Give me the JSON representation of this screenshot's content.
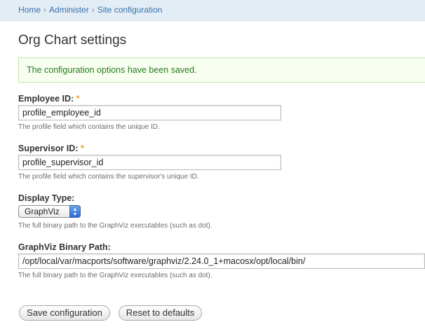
{
  "breadcrumb": {
    "items": [
      "Home",
      "Administer",
      "Site configuration"
    ],
    "separator": "›"
  },
  "page_title": "Org Chart settings",
  "status_message": "The configuration options have been saved.",
  "form": {
    "required_marker": "*",
    "employee_id": {
      "label": "Employee ID:",
      "value": "profile_employee_id",
      "description": "The profile field which contains the unique ID."
    },
    "supervisor_id": {
      "label": "Supervisor ID:",
      "value": "profile_supervisor_id",
      "description": "The profile field which contains the supervisor's unique ID."
    },
    "display_type": {
      "label": "Display Type:",
      "selected": "GraphViz",
      "description": "The full binary path to the GraphViz executables (such as dot)."
    },
    "graphviz_path": {
      "label": "GraphViz Binary Path:",
      "value": "/opt/local/var/macports/software/graphviz/2.24.0_1+macosx/opt/local/bin/",
      "description": "The full binary path to the GraphViz executables (such as dot)."
    },
    "buttons": {
      "save": "Save configuration",
      "reset": "Reset to defaults"
    }
  },
  "colors": {
    "breadcrumb_bg": "#e2edf6",
    "link": "#3a71a8",
    "success_bg": "#f8fff0",
    "success_border": "#bde5a2",
    "success_text": "#287a1f",
    "required": "#f6a123"
  }
}
